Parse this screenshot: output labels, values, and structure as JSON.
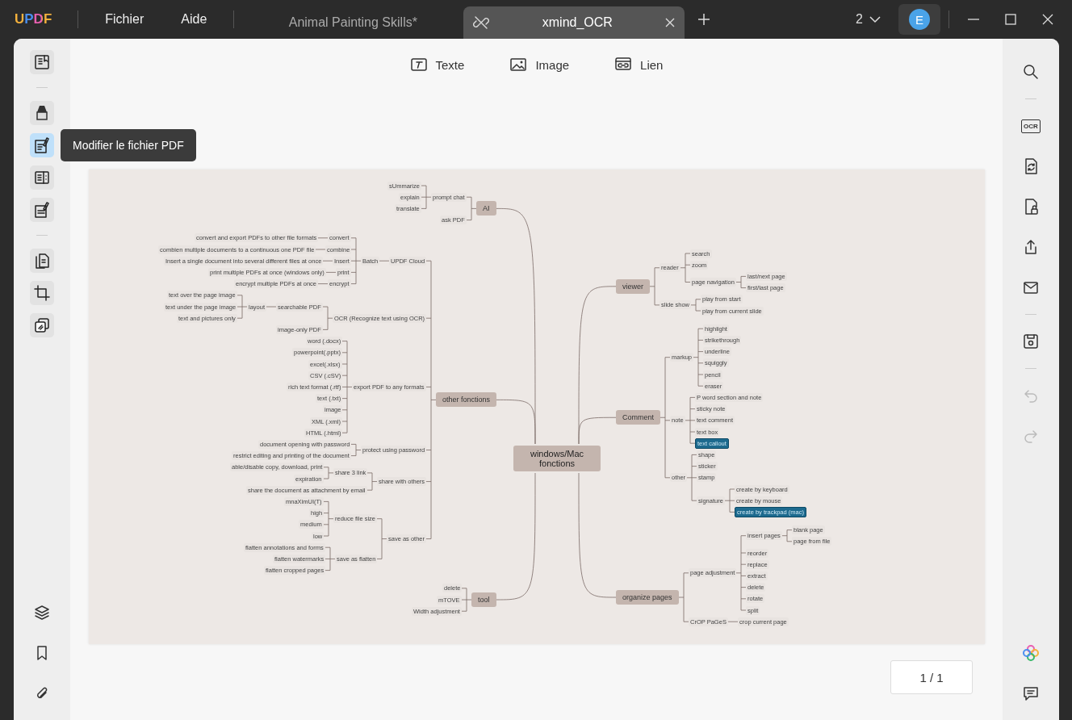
{
  "app": {
    "logo": "UPDF",
    "menu": [
      "Fichier",
      "Aide"
    ]
  },
  "tabs": [
    {
      "title": "Animal Painting Skills*",
      "selected": false
    },
    {
      "title": "xmind_OCR",
      "selected": true
    }
  ],
  "window_count": "2",
  "account": {
    "initial": "E"
  },
  "left_toolbar": {
    "tools": [
      {
        "kind": "reader",
        "selected": false
      },
      {
        "kind": "sep"
      },
      {
        "kind": "highlighter",
        "selected": false
      },
      {
        "kind": "edit",
        "selected": true
      },
      {
        "kind": "pages",
        "selected": false
      },
      {
        "kind": "form",
        "selected": false
      },
      {
        "kind": "sep"
      },
      {
        "kind": "organize",
        "selected": false
      },
      {
        "kind": "crop",
        "selected": false
      },
      {
        "kind": "overlay",
        "selected": false
      }
    ],
    "bottom": [
      {
        "kind": "layers"
      },
      {
        "kind": "bookmark"
      },
      {
        "kind": "attachment"
      }
    ]
  },
  "tooltip": {
    "text": "Modifier le fichier PDF"
  },
  "edit_toolbar": [
    {
      "kind": "text",
      "label": "Texte"
    },
    {
      "kind": "image",
      "label": "Image"
    },
    {
      "kind": "link",
      "label": "Lien"
    }
  ],
  "right_toolbar": [
    {
      "kind": "search",
      "disabled": false
    },
    {
      "kind": "sep"
    },
    {
      "kind": "ocr",
      "label": "OCR",
      "disabled": false
    },
    {
      "kind": "convert",
      "disabled": false
    },
    {
      "kind": "protect",
      "disabled": false
    },
    {
      "kind": "share",
      "disabled": false
    },
    {
      "kind": "mail",
      "disabled": false
    },
    {
      "kind": "sep"
    },
    {
      "kind": "save",
      "disabled": false
    },
    {
      "kind": "sep"
    },
    {
      "kind": "undo",
      "disabled": true
    },
    {
      "kind": "redo",
      "disabled": true
    }
  ],
  "right_bottom": [
    {
      "kind": "ai"
    },
    {
      "kind": "comment"
    }
  ],
  "page_indicator": "1 / 1",
  "mindmap": {
    "center": "windows/Mac fonctions",
    "left": [
      {
        "text": "AI",
        "children": [
          {
            "text": "prompt chat",
            "children": [
              {
                "text": "sUmmarize"
              },
              {
                "text": "explain"
              },
              {
                "text": "translate"
              }
            ]
          },
          {
            "text": "ask PDF"
          }
        ]
      },
      {
        "text": "other fonctions",
        "children": [
          {
            "text": "UPDF Cloud",
            "children": [
              {
                "text": "Batch",
                "children": [
                  {
                    "text": "convert",
                    "children": [
                      {
                        "text": "convert and export PDFs to other file formats"
                      }
                    ]
                  },
                  {
                    "text": "combine",
                    "children": [
                      {
                        "text": "combien multiple documents to a continuous one PDF file"
                      }
                    ]
                  },
                  {
                    "text": "Insert",
                    "children": [
                      {
                        "text": "Insert a single document into several different files at once"
                      }
                    ]
                  },
                  {
                    "text": "print",
                    "children": [
                      {
                        "text": "print multiple PDFs at once (windows only)"
                      }
                    ]
                  },
                  {
                    "text": "encrypt",
                    "children": [
                      {
                        "text": "encrypt multiple PDFs at once"
                      }
                    ]
                  }
                ]
              }
            ]
          },
          {
            "text": "OCR (Recognize text using OCR)",
            "children": [
              {
                "text": "searchable PDF",
                "children": [
                  {
                    "text": "layout",
                    "children": [
                      {
                        "text": "text over the page image"
                      },
                      {
                        "text": "text under the page image"
                      },
                      {
                        "text": "text and pictures only"
                      }
                    ]
                  }
                ]
              },
              {
                "text": "image-only PDF"
              }
            ]
          },
          {
            "text": "export PDF to any formats",
            "children": [
              {
                "text": "word (.docx)"
              },
              {
                "text": "powerpoint(.pptx)"
              },
              {
                "text": "excel(.xlsx)"
              },
              {
                "text": "CSV (.cSV)"
              },
              {
                "text": "rich text format (.rtf)"
              },
              {
                "text": "text (.txt)"
              },
              {
                "text": "image"
              },
              {
                "text": "XML (.xml)"
              },
              {
                "text": "HTML (.html)"
              }
            ]
          },
          {
            "text": "protect using password",
            "children": [
              {
                "text": "document opening with password"
              },
              {
                "text": "restrict editing and printing of the document"
              }
            ]
          },
          {
            "text": "share with others",
            "children": [
              {
                "text": "share 3 link",
                "children": [
                  {
                    "text": "able/disable copy, download, print"
                  },
                  {
                    "text": "expiration"
                  }
                ]
              },
              {
                "text": "share the document as attachment by email"
              }
            ]
          },
          {
            "text": "save as other",
            "children": [
              {
                "text": "reduce file size",
                "children": [
                  {
                    "text": "mnaXimUI(T)"
                  },
                  {
                    "text": "high"
                  },
                  {
                    "text": "medium"
                  },
                  {
                    "text": "low"
                  }
                ]
              },
              {
                "text": "save as flatten",
                "children": [
                  {
                    "text": "flatten annotations and forms"
                  },
                  {
                    "text": "flatten watermarks"
                  },
                  {
                    "text": "flatten cropped pages"
                  }
                ]
              }
            ]
          }
        ]
      },
      {
        "text": "tool",
        "children": [
          {
            "text": "delete"
          },
          {
            "text": "mTOVE"
          },
          {
            "text": "Width adjustment"
          }
        ]
      }
    ],
    "right": [
      {
        "text": "viewer",
        "children": [
          {
            "text": "reader",
            "children": [
              {
                "text": "search"
              },
              {
                "text": "zoom"
              },
              {
                "text": "page navigation",
                "children": [
                  {
                    "text": "last/next page"
                  },
                  {
                    "text": "first/last page"
                  }
                ]
              }
            ]
          },
          {
            "text": "slide show",
            "children": [
              {
                "text": "play from start"
              },
              {
                "text": "play from current slide"
              }
            ]
          }
        ]
      },
      {
        "text": "Comment",
        "children": [
          {
            "text": "markup",
            "children": [
              {
                "text": "highlight"
              },
              {
                "text": "strikethrough"
              },
              {
                "text": "underline"
              },
              {
                "text": "squiggly"
              },
              {
                "text": "pencil"
              },
              {
                "text": "eraser"
              }
            ]
          },
          {
            "text": "note",
            "children": [
              {
                "text": "P word section and note",
                "highlighted": false
              },
              {
                "text": "sticky note",
                "highlighted": false
              },
              {
                "text": "text comment",
                "highlighted": false
              },
              {
                "text": "text box",
                "highlighted": false
              },
              {
                "text": "text callout",
                "highlighted": true
              }
            ]
          },
          {
            "text": "other",
            "children": [
              {
                "text": "shape"
              },
              {
                "text": "sticker"
              },
              {
                "text": "stamp"
              },
              {
                "text": "signature",
                "children": [
                  {
                    "text": "create by keyboard",
                    "highlighted": false
                  },
                  {
                    "text": "create by mouse",
                    "highlighted": false
                  },
                  {
                    "text": "create by trackpad (mac)",
                    "highlighted": true
                  }
                ]
              }
            ]
          }
        ]
      },
      {
        "text": "organize pages",
        "children": [
          {
            "text": "page adjustment",
            "children": [
              {
                "text": "insert pages",
                "children": [
                  {
                    "text": "blank page"
                  },
                  {
                    "text": "page from file"
                  }
                ]
              },
              {
                "text": "reorder"
              },
              {
                "text": "replace"
              },
              {
                "text": "extract"
              },
              {
                "text": "delete"
              },
              {
                "text": "rotate"
              },
              {
                "text": "split"
              }
            ]
          },
          {
            "text": "CrOP PaGeS",
            "children": [
              {
                "text": "crop current page"
              }
            ]
          }
        ]
      }
    ]
  }
}
